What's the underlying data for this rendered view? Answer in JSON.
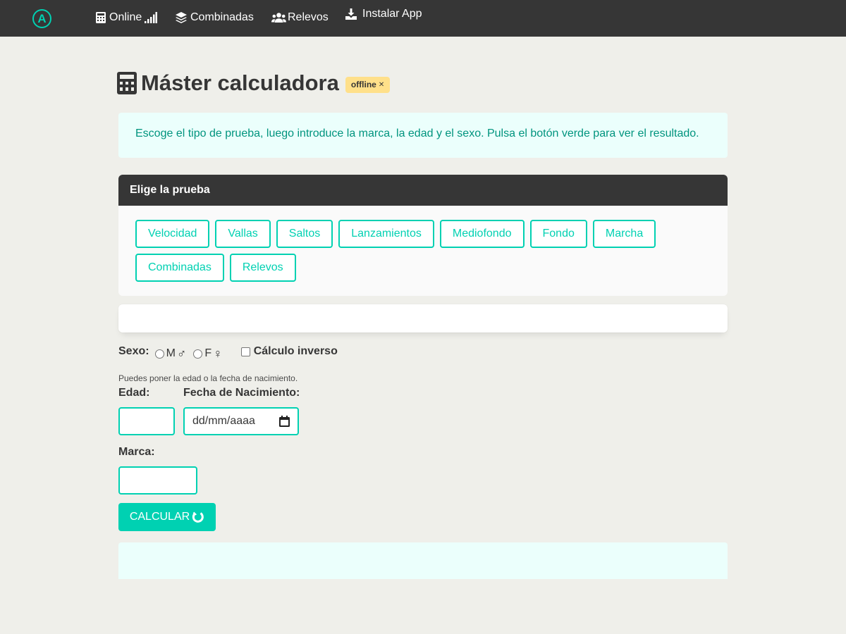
{
  "navbar": {
    "logo_letter": "A",
    "items": [
      {
        "label": "Online",
        "icon": "calculator-icon"
      },
      {
        "label": "Combinadas",
        "icon": "layers-icon"
      },
      {
        "label": "Relevos",
        "icon": "users-icon"
      },
      {
        "label": "Instalar App",
        "icon": "download-icon"
      }
    ]
  },
  "page": {
    "title": "Máster calculadora",
    "tag": "offline",
    "tag_close": "✕"
  },
  "notification": {
    "text": "Escoge el tipo de prueba, luego introduce la marca, la edad y el sexo. Pulsa el botón verde para ver el resultado."
  },
  "panel": {
    "heading": "Elige la prueba",
    "events": [
      "Velocidad",
      "Vallas",
      "Saltos",
      "Lanzamientos",
      "Mediofondo",
      "Fondo",
      "Marcha",
      "Combinadas",
      "Relevos"
    ]
  },
  "form": {
    "sexo_label": "Sexo:",
    "option_m": "M",
    "symbol_m": "♂",
    "option_f": "F",
    "symbol_f": "♀",
    "inverse_label": "Cálculo inverso",
    "help_text": "Puedes poner la edad o la fecha de nacimiento.",
    "edad_label": "Edad:",
    "fecha_label": "Fecha de Nacimiento:",
    "fecha_placeholder": "dd/mm/aaaa",
    "marca_label": "Marca:",
    "calc_button": "CALCULAR"
  },
  "colors": {
    "primary": "#00d1b2",
    "dark": "#363636",
    "warning": "#ffe08a",
    "light_bg": "#ebfffc"
  }
}
